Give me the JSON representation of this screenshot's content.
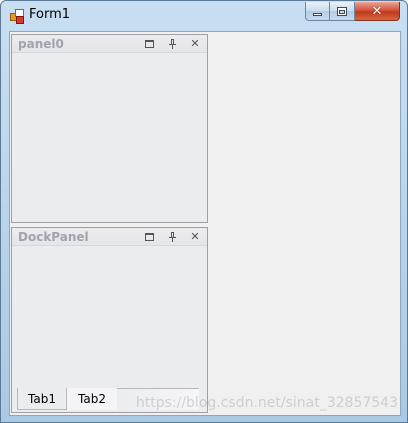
{
  "window": {
    "title": "Form1"
  },
  "panels": [
    {
      "title": "panel0"
    },
    {
      "title": "DockPanel",
      "tabs": [
        "Tab1",
        "Tab2"
      ]
    }
  ],
  "watermark": "https://blog.csdn.net/sinat_32857543",
  "icons": {
    "app": "form-icon",
    "minimize": "minimize-icon",
    "maximize": "maximize-icon",
    "close": "close-icon",
    "panel_restore": "restore-icon",
    "panel_pin": "pin-icon",
    "panel_close": "close-icon"
  },
  "colors": {
    "close_button": "#c13a1e",
    "panel_bg": "#ebecf0",
    "client_bg": "#f0f0f0"
  }
}
